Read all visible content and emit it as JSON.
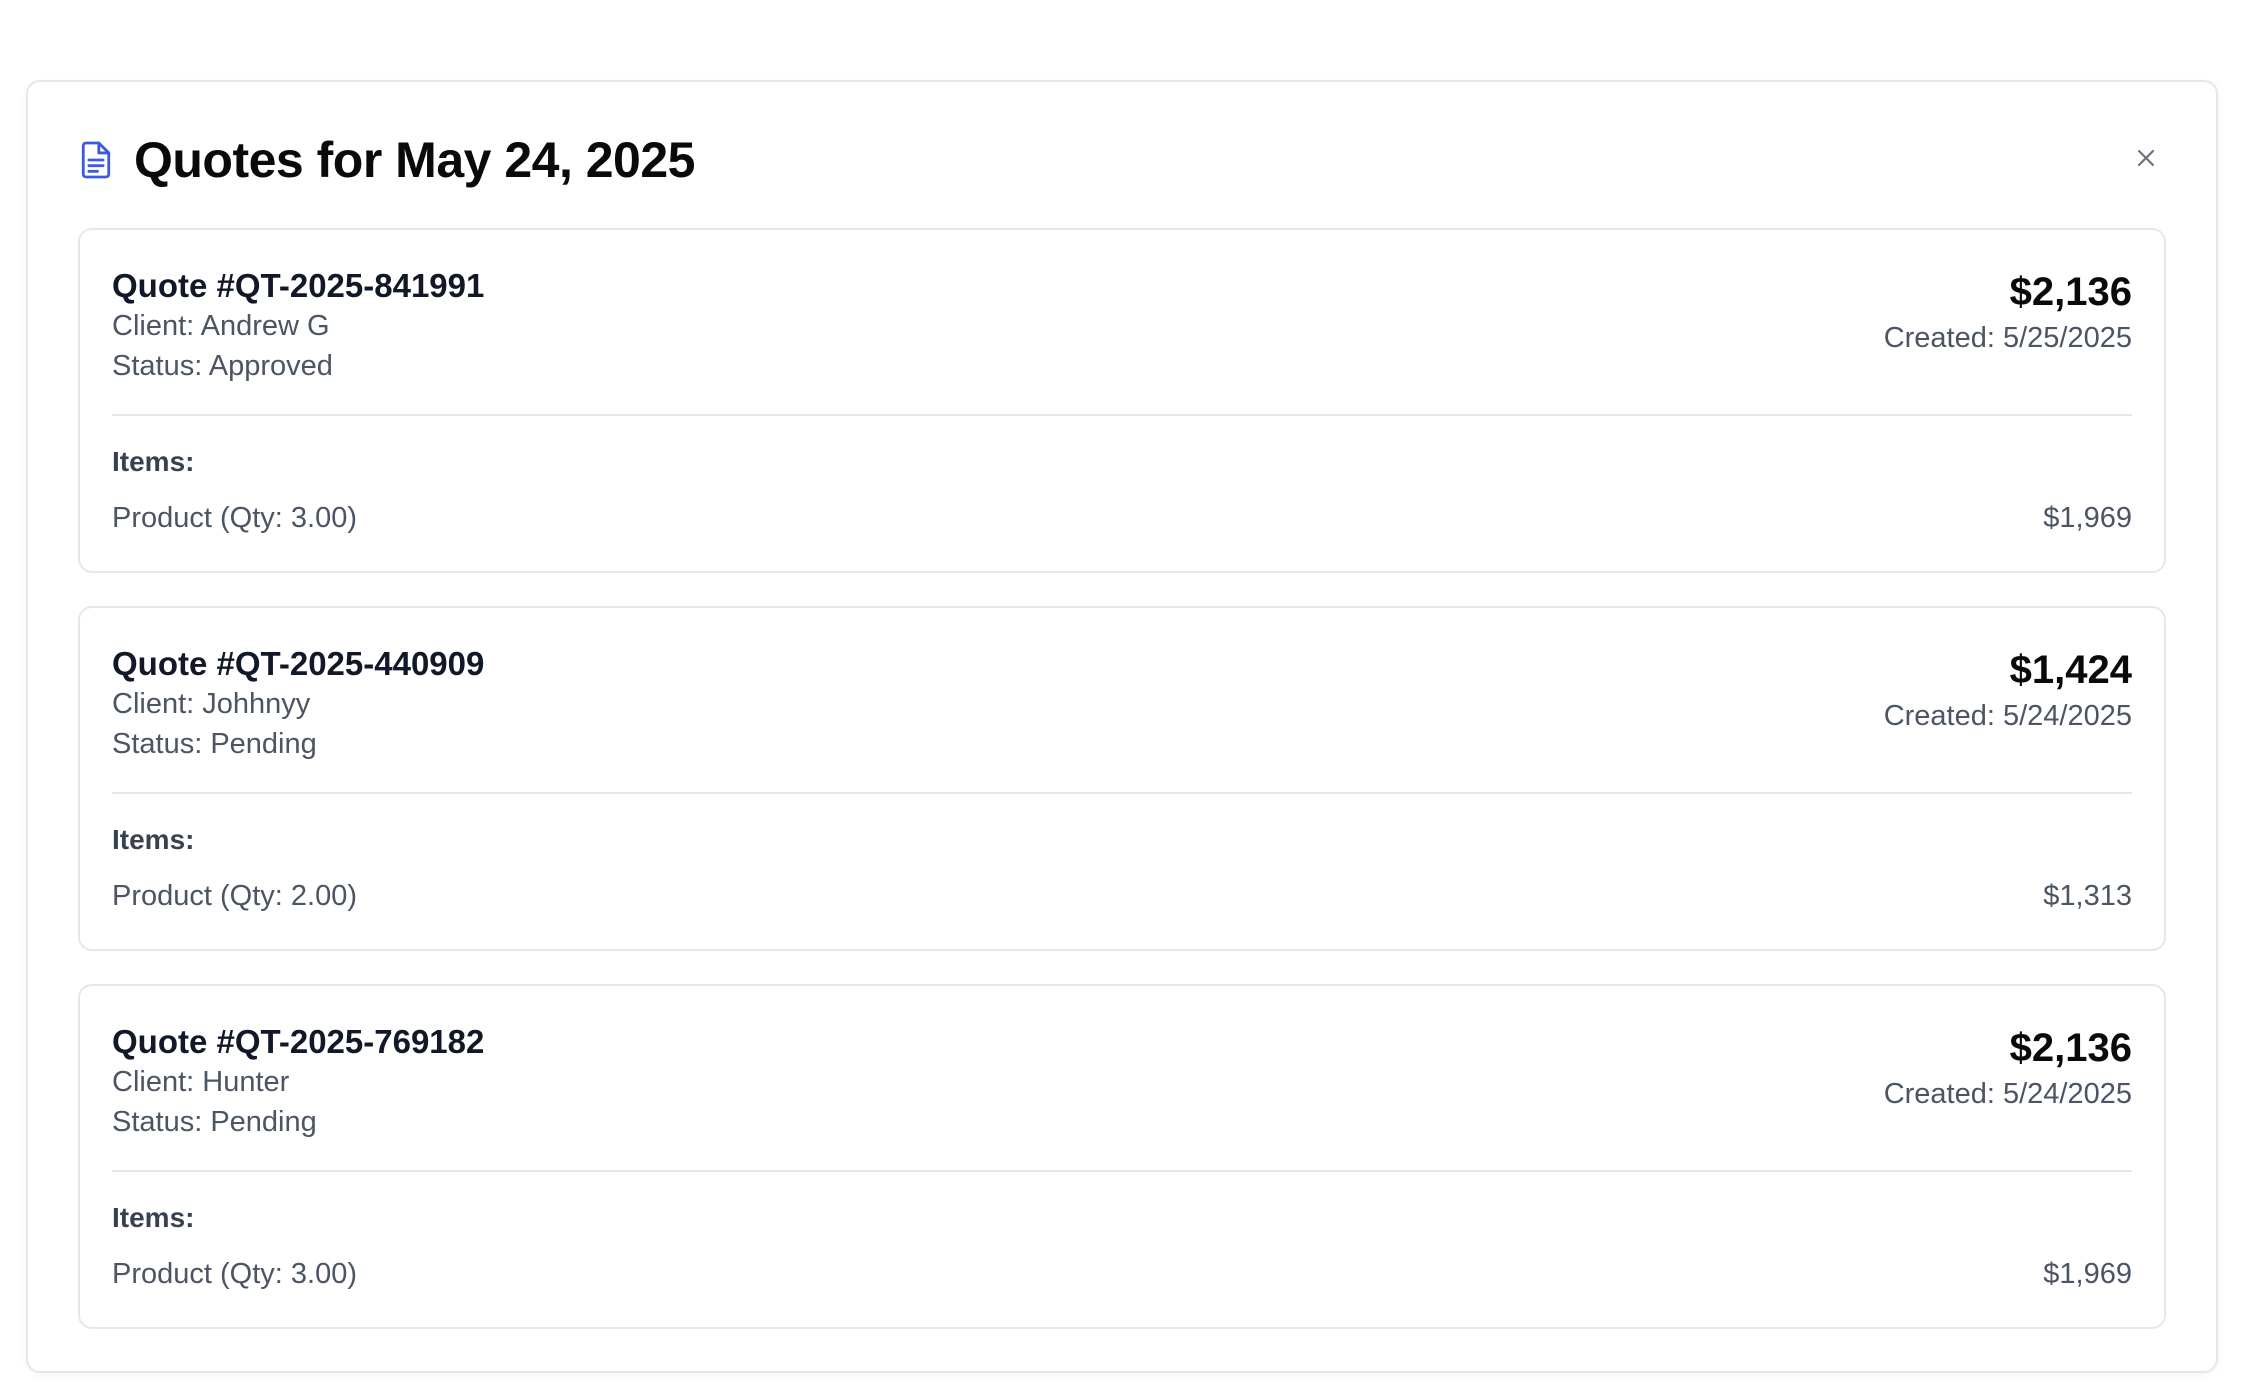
{
  "modal": {
    "title": "Quotes for May 24, 2025",
    "title_icon": "document-icon",
    "close_icon": "close-icon"
  },
  "labels": {
    "items": "Items:"
  },
  "quotes": [
    {
      "number": "Quote #QT-2025-841991",
      "client": "Client: Andrew G",
      "status": "Status: Approved",
      "total": "$2,136",
      "created": "Created: 5/25/2025",
      "items": [
        {
          "name": "Product (Qty: 3.00)",
          "amount": "$1,969"
        }
      ]
    },
    {
      "number": "Quote #QT-2025-440909",
      "client": "Client: Johhnyy",
      "status": "Status: Pending",
      "total": "$1,424",
      "created": "Created: 5/24/2025",
      "items": [
        {
          "name": "Product (Qty: 2.00)",
          "amount": "$1,313"
        }
      ]
    },
    {
      "number": "Quote #QT-2025-769182",
      "client": "Client: Hunter",
      "status": "Status: Pending",
      "total": "$2,136",
      "created": "Created: 5/24/2025",
      "items": [
        {
          "name": "Product (Qty: 3.00)",
          "amount": "$1,969"
        }
      ]
    }
  ],
  "colors": {
    "accent": "#3b5bdb",
    "border": "#e5e7eb",
    "text_primary": "#0a0a0a",
    "text_secondary": "#4b5563"
  }
}
